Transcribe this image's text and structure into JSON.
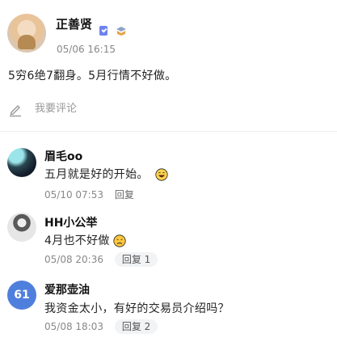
{
  "post": {
    "author": "正善贤",
    "time": "05/06 16:15",
    "text": "5穷6绝7翻身。5月行情不好做。"
  },
  "comment_input": {
    "placeholder": "我要评论"
  },
  "comments": [
    {
      "name": "眉毛oo",
      "text": "五月就是好的开始。",
      "emoji": "laughing-emoji",
      "time": "05/10 07:53",
      "reply_label": "回复"
    },
    {
      "name": "HH小公举",
      "text": "4月也不好做",
      "emoji": "frowning-emoji",
      "time": "05/08 20:36",
      "reply_label": "回复 1"
    },
    {
      "name": "爱那壶油",
      "avatar_text": "61",
      "text": "我资金太小，有好的交易员介绍吗？",
      "time": "05/08 18:03",
      "reply_label": "回复 2"
    }
  ],
  "colors": {
    "accent_blue": "#4f7fdc",
    "verified": "#6d82ee",
    "muted": "#888888"
  }
}
